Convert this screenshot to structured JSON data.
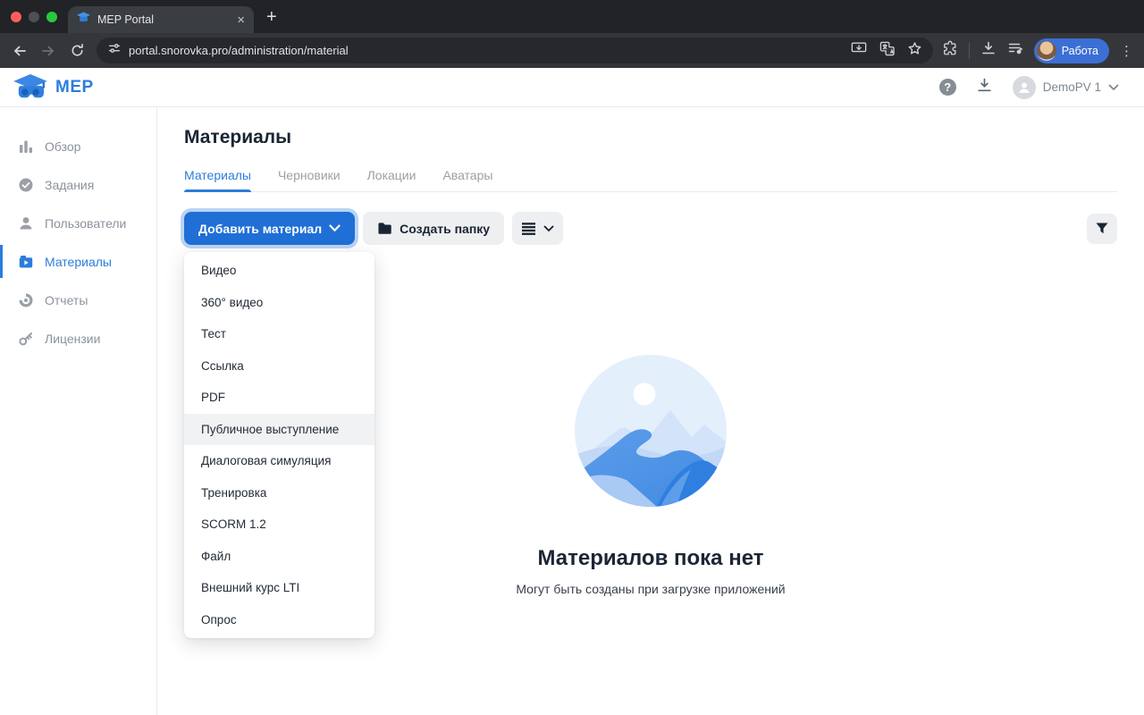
{
  "browser": {
    "tab_title": "MEP Portal",
    "url": "portal.snorovka.pro/administration/material",
    "profile_label": "Работа"
  },
  "header": {
    "logo_text": "MEP",
    "user_name": "DemoPV 1"
  },
  "sidebar": {
    "items": [
      {
        "label": "Обзор",
        "icon": "bar-chart-icon",
        "active": false
      },
      {
        "label": "Задания",
        "icon": "check-circle-icon",
        "active": false
      },
      {
        "label": "Пользователи",
        "icon": "person-icon",
        "active": false
      },
      {
        "label": "Материалы",
        "icon": "video-library-icon",
        "active": true
      },
      {
        "label": "Отчеты",
        "icon": "donut-chart-icon",
        "active": false
      },
      {
        "label": "Лицензии",
        "icon": "key-icon",
        "active": false
      }
    ]
  },
  "main": {
    "page_title": "Материалы",
    "tabs": [
      {
        "label": "Материалы",
        "active": true
      },
      {
        "label": "Черновики",
        "active": false
      },
      {
        "label": "Локации",
        "active": false
      },
      {
        "label": "Аватары",
        "active": false
      }
    ],
    "toolbar": {
      "add_material_label": "Добавить материал",
      "create_folder_label": "Создать папку"
    },
    "dropdown": {
      "items": [
        "Видео",
        "360° видео",
        "Тест",
        "Ссылка",
        "PDF",
        "Публичное выступление",
        "Диалоговая симуляция",
        "Тренировка",
        "SCORM 1.2",
        "Файл",
        "Внешний курс LTI",
        "Опрос"
      ],
      "highlighted_item": "Публичное выступление",
      "highlighted_index": 5
    },
    "empty_state": {
      "title": "Материалов пока нет",
      "subtitle": "Могут быть созданы при загрузке приложений"
    }
  },
  "colors": {
    "accent_blue": "#1f6fd6",
    "link_blue": "#2b7ddb",
    "dark_text": "#1a2433",
    "sidebar_gray": "#8b929b",
    "profile_pill_blue": "#3b6fd4",
    "focus_ring": "#b9d4f3"
  },
  "icons": {
    "tab_favicon": "graduation-cap",
    "filter": "funnel",
    "view_mode": "dense-list",
    "create_folder": "folder"
  }
}
